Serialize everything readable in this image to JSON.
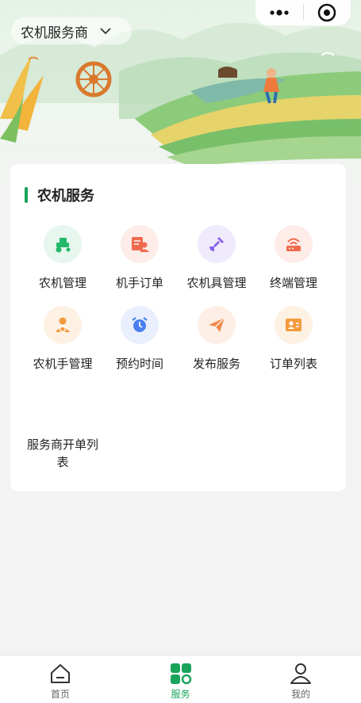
{
  "header": {
    "role_label": "农机服务商"
  },
  "section": {
    "title": "农机服务"
  },
  "services": [
    {
      "label": "农机管理",
      "icon": "tractor-icon",
      "color": "#22b86b",
      "bg": "#e7f6ee"
    },
    {
      "label": "机手订单",
      "icon": "operator-order-icon",
      "color": "#ef6b4e",
      "bg": "#fdece7"
    },
    {
      "label": "农机具管理",
      "icon": "shovel-icon",
      "color": "#8a63e8",
      "bg": "#efeafc"
    },
    {
      "label": "终端管理",
      "icon": "router-icon",
      "color": "#ef6b4e",
      "bg": "#fdece7"
    },
    {
      "label": "农机手管理",
      "icon": "driver-icon",
      "color": "#f39a3d",
      "bg": "#fdf1e4"
    },
    {
      "label": "预约时间",
      "icon": "alarm-clock-icon",
      "color": "#4a7ff0",
      "bg": "#e9effc"
    },
    {
      "label": "发布服务",
      "icon": "paper-plane-icon",
      "color": "#f08a4b",
      "bg": "#fdefe6"
    },
    {
      "label": "订单列表",
      "icon": "user-list-icon",
      "color": "#f39a3d",
      "bg": "#fdf1e4"
    },
    {
      "label": "服务商开单列表",
      "icon": "",
      "color": "",
      "bg": ""
    }
  ],
  "tabbar": {
    "items": [
      {
        "label": "首页",
        "icon": "home-icon"
      },
      {
        "label": "服务",
        "icon": "grid-icon"
      },
      {
        "label": "我的",
        "icon": "user-icon"
      }
    ],
    "active": "服务",
    "active_color": "#1aa35a"
  },
  "colors": {
    "accent": "#1aa35a"
  }
}
